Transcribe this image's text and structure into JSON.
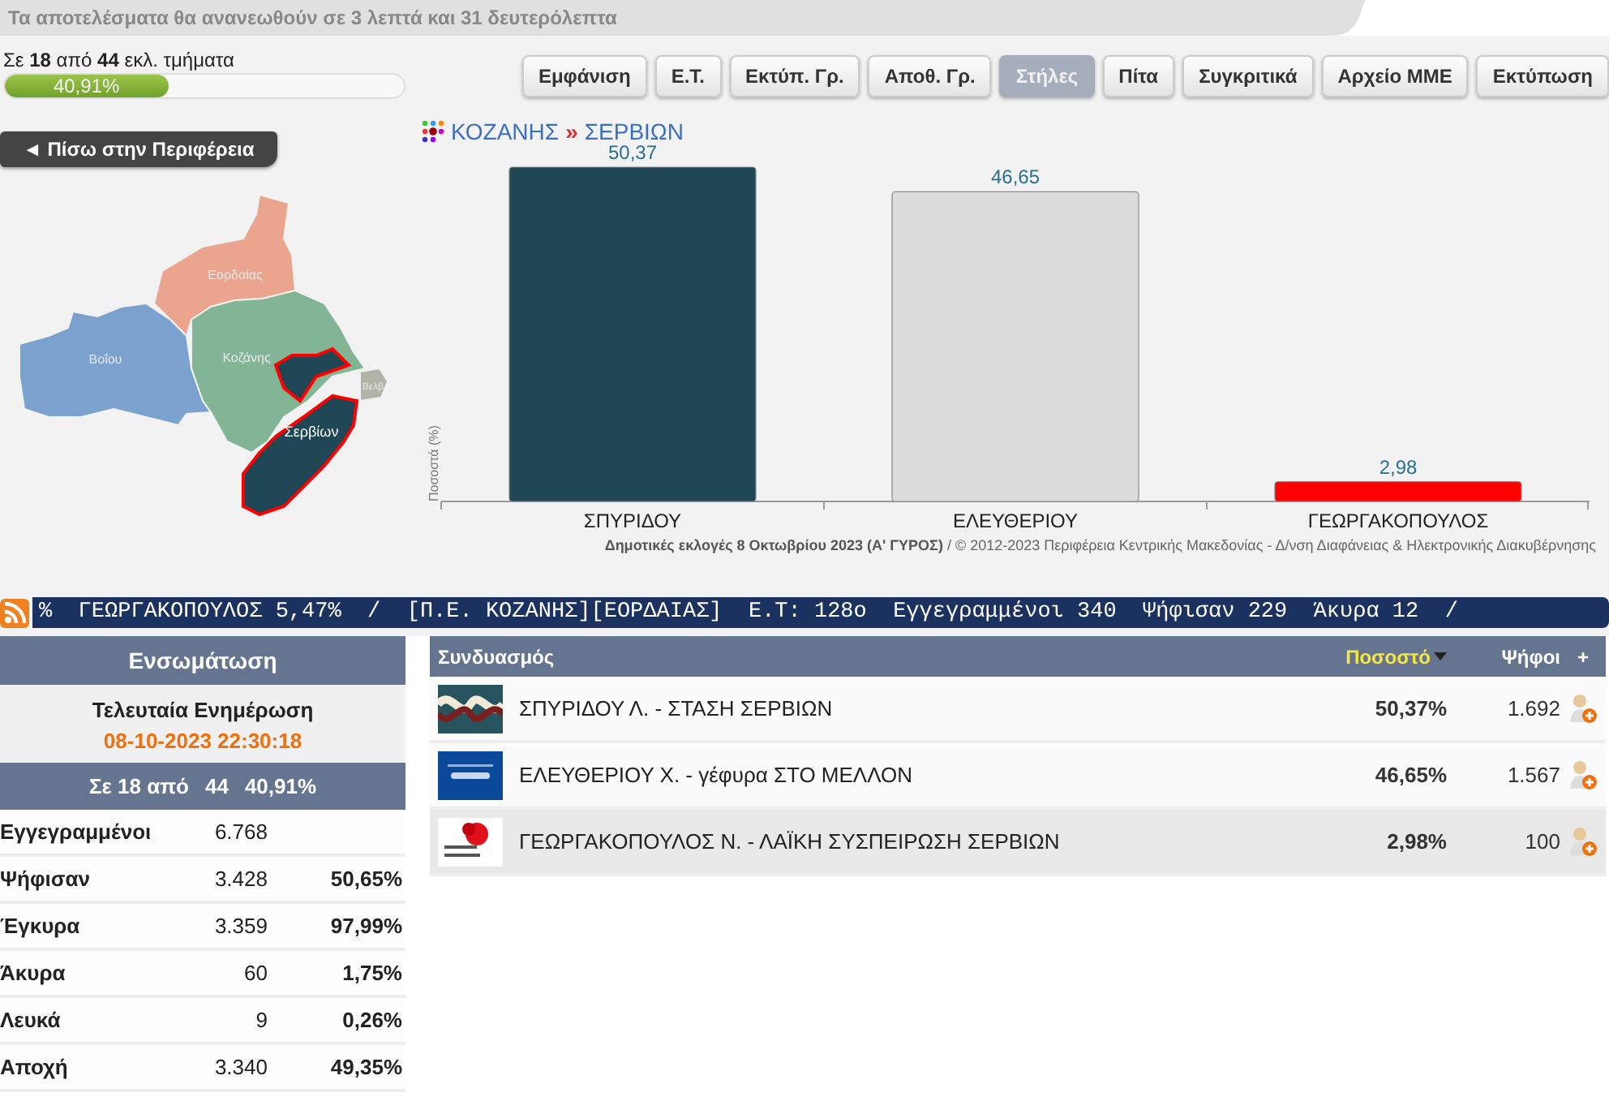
{
  "refresh_notice": "Τα αποτελέσματα θα ανανεωθούν σε 3 λεπτά και 31 δευτερόλεπτα",
  "progress": {
    "label": "Σε **18** από **44** εκλ. τμήματα",
    "level": 0.4091,
    "reading": "40,91%"
  },
  "toolbar": [
    {
      "label": "Εμφάνιση",
      "selected": false
    },
    {
      "label": "Ε.Τ.",
      "selected": false
    },
    {
      "label": "Εκτύπ. Γρ.",
      "selected": false
    },
    {
      "label": "Αποθ. Γρ.",
      "selected": false
    },
    {
      "label": "Στήλες",
      "selected": true
    },
    {
      "label": "Πίτα",
      "selected": false
    },
    {
      "label": "Συγκριτικά",
      "selected": false
    },
    {
      "label": "Αρχείο ΜΜΕ",
      "selected": false
    },
    {
      "label": "Εκτύπωση",
      "selected": false
    }
  ],
  "back_button": "◄ Πίσω στην Περιφέρεια",
  "map": {
    "regions": [
      {
        "name": "Εορδαίας",
        "color": "#eba58e",
        "selected": false
      },
      {
        "name": "Βοΐου",
        "color": "#7ba1cf",
        "selected": false
      },
      {
        "name": "Κοζάνης",
        "color": "#82b596",
        "selected": false
      },
      {
        "name": "Βελβ",
        "color": "#b1b3a6",
        "selected": false
      },
      {
        "name": "Σερβίων",
        "color": "#1e4655",
        "selected": true
      }
    ]
  },
  "breadcrumb": {
    "items": [
      "ΚΟΖΑΝΗΣ",
      "ΣΕΡΒΙΩΝ"
    ],
    "separator": "»"
  },
  "chart_data": {
    "type": "bar",
    "ylabel": "Ποσοστά (%)",
    "categories": [
      "ΣΠΥΡΙΔΟΥ",
      "ΕΛΕΥΘΕΡΙΟΥ",
      "ΓΕΩΡΓΑΚΟΠΟΥΛΟΣ"
    ],
    "data_labels": true,
    "series": [
      {
        "values": [
          50.37,
          46.65,
          2.98
        ],
        "colors": [
          "#1e4655",
          "#dcdcdc",
          "#ff0000"
        ],
        "value_labels": [
          "50,37",
          "46,65",
          "2,98"
        ]
      }
    ]
  },
  "footer": "**Δημοτικές εκλογές 8 Οκτωβρίου 2023 (Α' ΓΥΡΟΣ)** / © 2012-2023 Περιφέρεια Κεντρικής Μακεδονίας - Δ/νση Διαφάνειας & Ηλεκτρονικής Διακυβέρνησης",
  "ticker": "%  ΓΕΩΡΓΑΚΟΠΟΥΛΟΣ 5,47%  /  [Π.Ε. ΚΟΖΑΝΗΣ][ΕΟΡΔΑΙΑΣ]  Ε.Τ: 128ο  Εγγεγραμμένοι 340  Ψήφισαν 229  Άκυρα 12  /",
  "integration": {
    "title": "Ενσωμάτωση",
    "update_label": "Τελευταία Ενημέρωση",
    "update_time": "08-10-2023 22:30:18",
    "summary": [
      "Σε 18 από",
      "44",
      "40,91%"
    ],
    "rows": [
      {
        "label": "Εγγεγραμμένοι",
        "count": "6.768"
      },
      {
        "label": "Ψήφισαν",
        "count": "3.428",
        "percent": "50,65%"
      },
      {
        "label": "Έγκυρα",
        "count": "3.359",
        "percent": "97,99%"
      },
      {
        "label": "Άκυρα",
        "count": "60",
        "percent": "1,75%"
      },
      {
        "label": "Λευκά",
        "count": "9",
        "percent": "0,26%"
      },
      {
        "label": "Αποχή",
        "count": "3.340",
        "percent": "49,35%"
      }
    ]
  },
  "results": {
    "columns": [
      {
        "label": "Συνδυασμός",
        "sorted": false
      },
      {
        "label": "Ποσοστό",
        "sorted": true
      },
      {
        "label": "Ψήφοι",
        "sorted": false
      },
      {
        "label": "+",
        "sorted": false
      }
    ],
    "rows": [
      {
        "name": "ΣΠΥΡΙΔΟΥ Λ. - ΣΤΑΣΗ ΣΕΡΒΙΩΝ",
        "percent": "50,37%",
        "votes": "1.692",
        "kind": "wave",
        "selected": false
      },
      {
        "name": "ΕΛΕΥΘΕΡΙΟΥ Χ. - γέφυρα ΣΤΟ ΜΕΛΛΟΝ",
        "percent": "46,65%",
        "votes": "1.567",
        "kind": "blue",
        "selected": false
      },
      {
        "name": "ΓΕΩΡΓΑΚΟΠΟΥΛΟΣ Ν. - ΛΑΪΚΗ ΣΥΣΠΕΙΡΩΣΗ ΣΕΡΒΙΩΝ",
        "percent": "2,98%",
        "votes": "100",
        "kind": "flower",
        "selected": true
      }
    ]
  }
}
